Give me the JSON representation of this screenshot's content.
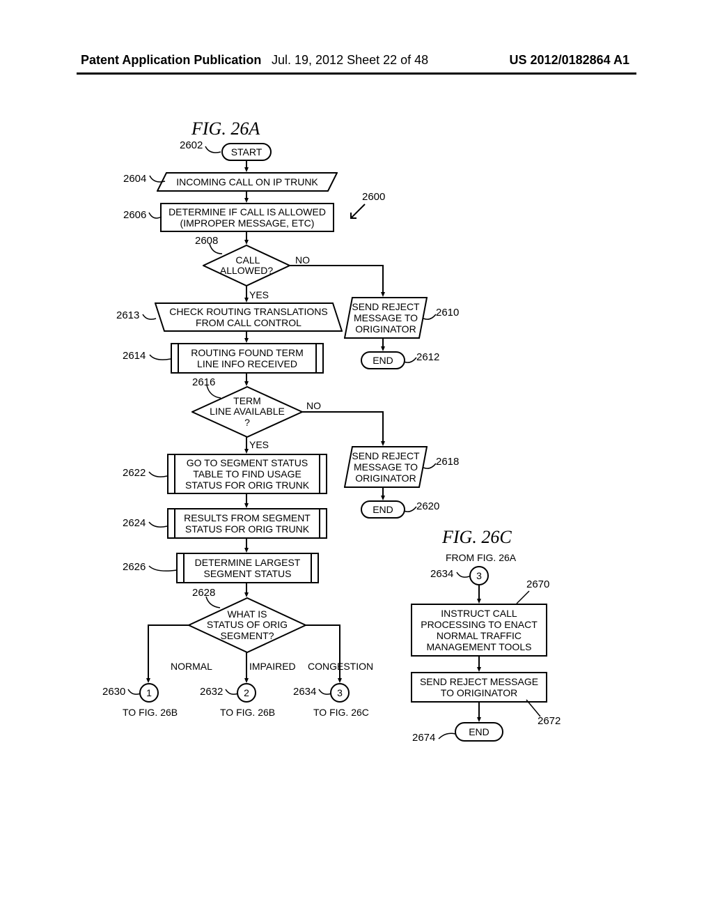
{
  "header": {
    "left": "Patent Application Publication",
    "center": "Jul. 19, 2012   Sheet 22 of 48",
    "right": "US 2012/0182864 A1"
  },
  "fig26a": {
    "title": "FIG. 26A",
    "ref_overall": "2600",
    "nodes": {
      "start": {
        "ref": "2602",
        "text": "START"
      },
      "incoming": {
        "ref": "2604",
        "text": "INCOMING CALL ON IP TRUNK"
      },
      "allowed_rect": {
        "ref": "2606",
        "text": "DETERMINE IF CALL IS ALLOWED\n(IMPROPER MESSAGE, ETC)"
      },
      "call_allowed": {
        "ref": "2608",
        "text": " CALL\nALLOWED?",
        "yes": "YES",
        "no": "NO"
      },
      "reject1": {
        "ref": "2610",
        "text": "SEND REJECT\nMESSAGE TO\nORIGINATOR"
      },
      "end1": {
        "ref": "2612",
        "text": "END"
      },
      "check_routing": {
        "ref": "2613",
        "text": "CHECK ROUTING TRANSLATIONS\nFROM CALL CONTROL"
      },
      "routing_found": {
        "ref": "2614",
        "text": "ROUTING FOUND TERM\nLINE INFO RECEIVED"
      },
      "term_avail": {
        "ref": "2616",
        "text": "TERM\nLINE AVAILABLE\n?",
        "yes": "YES",
        "no": "NO"
      },
      "reject2": {
        "ref": "2618",
        "text": "SEND REJECT\nMESSAGE TO\nORIGINATOR"
      },
      "end2": {
        "ref": "2620",
        "text": "END"
      },
      "go_segment": {
        "ref": "2622",
        "text": "GO TO SEGMENT STATUS\nTABLE TO FIND USAGE\nSTATUS FOR ORIG TRUNK"
      },
      "results_segment": {
        "ref": "2624",
        "text": "RESULTS FROM SEGMENT\nSTATUS FOR ORIG TRUNK"
      },
      "determine_largest": {
        "ref": "2626",
        "text": "DETERMINE LARGEST\nSEGMENT STATUS"
      },
      "what_status": {
        "ref": "2628",
        "text": "WHAT IS\nSTATUS OF ORIG\nSEGMENT?"
      },
      "branch_labels": {
        "normal": "NORMAL",
        "impaired": "IMPAIRED",
        "congestion": "CONGESTION"
      },
      "conn1": {
        "ref": "2630",
        "num": "1",
        "to": "TO FIG. 26B"
      },
      "conn2": {
        "ref": "2632",
        "num": "2",
        "to": "TO FIG. 26B"
      },
      "conn3": {
        "ref": "2634",
        "num": "3",
        "to": "TO FIG. 26C"
      }
    }
  },
  "fig26c": {
    "title": "FIG. 26C",
    "from_label": "FROM FIG. 26A",
    "nodes": {
      "conn3": {
        "ref": "2634",
        "num": "3"
      },
      "instruct": {
        "ref": "2670",
        "text": "INSTRUCT CALL\nPROCESSING TO ENACT\nNORMAL TRAFFIC\nMANAGEMENT TOOLS"
      },
      "reject": {
        "ref": "2672",
        "text": "SEND REJECT MESSAGE\nTO ORIGINATOR"
      },
      "end": {
        "ref": "2674",
        "text": "END"
      }
    }
  },
  "chart_data": {
    "type": "flowchart",
    "figures": [
      "FIG. 26A",
      "FIG. 26C"
    ],
    "fig26a_flow": [
      {
        "id": "2602",
        "type": "terminator",
        "label": "START",
        "next": [
          "2604"
        ]
      },
      {
        "id": "2604",
        "type": "io",
        "label": "INCOMING CALL ON IP TRUNK",
        "next": [
          "2606"
        ]
      },
      {
        "id": "2606",
        "type": "process",
        "label": "DETERMINE IF CALL IS ALLOWED (IMPROPER MESSAGE, ETC)",
        "next": [
          "2608"
        ]
      },
      {
        "id": "2608",
        "type": "decision",
        "label": "CALL ALLOWED?",
        "yes": "2613",
        "no": "2610"
      },
      {
        "id": "2610",
        "type": "io",
        "label": "SEND REJECT MESSAGE TO ORIGINATOR",
        "next": [
          "2612"
        ]
      },
      {
        "id": "2612",
        "type": "terminator",
        "label": "END"
      },
      {
        "id": "2613",
        "type": "io",
        "label": "CHECK ROUTING TRANSLATIONS FROM CALL CONTROL",
        "next": [
          "2614"
        ]
      },
      {
        "id": "2614",
        "type": "subprocess",
        "label": "ROUTING FOUND TERM LINE INFO RECEIVED",
        "next": [
          "2616"
        ]
      },
      {
        "id": "2616",
        "type": "decision",
        "label": "TERM LINE AVAILABLE ?",
        "yes": "2622",
        "no": "2618"
      },
      {
        "id": "2618",
        "type": "io",
        "label": "SEND REJECT MESSAGE TO ORIGINATOR",
        "next": [
          "2620"
        ]
      },
      {
        "id": "2620",
        "type": "terminator",
        "label": "END"
      },
      {
        "id": "2622",
        "type": "subprocess",
        "label": "GO TO SEGMENT STATUS TABLE TO FIND USAGE STATUS FOR ORIG TRUNK",
        "next": [
          "2624"
        ]
      },
      {
        "id": "2624",
        "type": "subprocess",
        "label": "RESULTS FROM SEGMENT STATUS FOR ORIG TRUNK",
        "next": [
          "2626"
        ]
      },
      {
        "id": "2626",
        "type": "subprocess",
        "label": "DETERMINE LARGEST SEGMENT STATUS",
        "next": [
          "2628"
        ]
      },
      {
        "id": "2628",
        "type": "decision",
        "label": "WHAT IS STATUS OF ORIG SEGMENT?",
        "branches": {
          "NORMAL": "2630",
          "IMPAIRED": "2632",
          "CONGESTION": "2634"
        }
      },
      {
        "id": "2630",
        "type": "connector",
        "label": "1",
        "to": "TO FIG. 26B"
      },
      {
        "id": "2632",
        "type": "connector",
        "label": "2",
        "to": "TO FIG. 26B"
      },
      {
        "id": "2634",
        "type": "connector",
        "label": "3",
        "to": "TO FIG. 26C"
      }
    ],
    "fig26c_flow": [
      {
        "id": "2634",
        "type": "connector",
        "label": "3",
        "from": "FROM FIG. 26A",
        "next": [
          "2670"
        ]
      },
      {
        "id": "2670",
        "type": "process",
        "label": "INSTRUCT CALL PROCESSING TO ENACT NORMAL TRAFFIC MANAGEMENT TOOLS",
        "next": [
          "2672"
        ]
      },
      {
        "id": "2672",
        "type": "process",
        "label": "SEND REJECT MESSAGE TO ORIGINATOR",
        "next": [
          "2674"
        ]
      },
      {
        "id": "2674",
        "type": "terminator",
        "label": "END"
      }
    ]
  }
}
